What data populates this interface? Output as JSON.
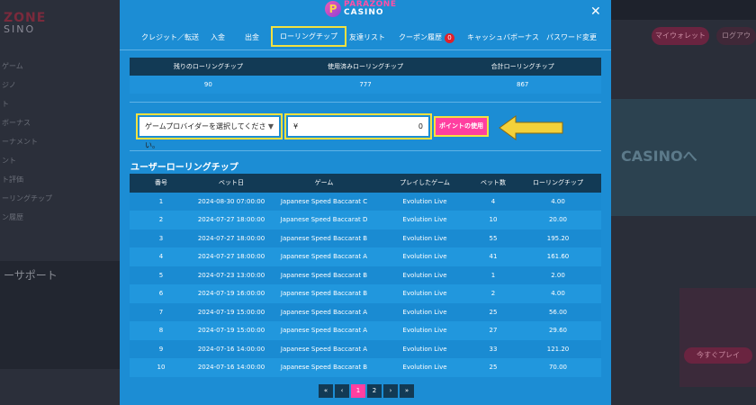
{
  "brand": {
    "line1": "PARAZONE",
    "line2": "CASINO",
    "badge": "P"
  },
  "background": {
    "logo_line1": "ZONE",
    "logo_line2": "SINO",
    "menu": [
      "ゲーム",
      "ジノ",
      "ト",
      "ボーナス",
      "ーナメント",
      "ント",
      "ト評価",
      "ーリングチップ",
      "ン履歴"
    ],
    "support_title": "ーサポート",
    "wallet_button": "マイウォレット",
    "login_button": "ログアウ",
    "banner_text": "CASINOへ",
    "lucky_button": "今すぐプレイ"
  },
  "tabs": [
    {
      "label": "クレジット／転送",
      "active": false
    },
    {
      "label": "入金",
      "active": false
    },
    {
      "label": "出金",
      "active": false
    },
    {
      "label": "ローリングチップ",
      "active": true
    },
    {
      "label": "友達リスト",
      "active": false
    },
    {
      "label": "クーポン履歴",
      "active": false,
      "badge": "0"
    },
    {
      "label": "キャッシュバボーナス",
      "active": false
    },
    {
      "label": "パスワード変更",
      "active": false
    }
  ],
  "summary": {
    "headers": [
      "残りのローリングチップ",
      "使用済みローリングチップ",
      "合計ローリングチップ"
    ],
    "values": [
      "90",
      "777",
      "867"
    ]
  },
  "controls": {
    "provider_select": "ゲームプロバイダーを選択してください。",
    "currency": "¥",
    "amount": "0",
    "use_button": "ポイントの使用"
  },
  "history": {
    "title": "ユーザーローリングチップ",
    "headers": [
      "番号",
      "ベット日",
      "ゲーム",
      "プレイしたゲーム",
      "ベット数",
      "ローリングチップ"
    ],
    "rows": [
      [
        "1",
        "2024-08-30 07:00:00",
        "Japanese Speed Baccarat C",
        "Evolution Live",
        "4",
        "4.00"
      ],
      [
        "2",
        "2024-07-27 18:00:00",
        "Japanese Speed Baccarat D",
        "Evolution Live",
        "10",
        "20.00"
      ],
      [
        "3",
        "2024-07-27 18:00:00",
        "Japanese Speed Baccarat B",
        "Evolution Live",
        "55",
        "195.20"
      ],
      [
        "4",
        "2024-07-27 18:00:00",
        "Japanese Speed Baccarat A",
        "Evolution Live",
        "41",
        "161.60"
      ],
      [
        "5",
        "2024-07-23 13:00:00",
        "Japanese Speed Baccarat B",
        "Evolution Live",
        "1",
        "2.00"
      ],
      [
        "6",
        "2024-07-19 16:00:00",
        "Japanese Speed Baccarat B",
        "Evolution Live",
        "2",
        "4.00"
      ],
      [
        "7",
        "2024-07-19 15:00:00",
        "Japanese Speed Baccarat A",
        "Evolution Live",
        "25",
        "56.00"
      ],
      [
        "8",
        "2024-07-19 15:00:00",
        "Japanese Speed Baccarat A",
        "Evolution Live",
        "27",
        "29.60"
      ],
      [
        "9",
        "2024-07-16 14:00:00",
        "Japanese Speed Baccarat A",
        "Evolution Live",
        "33",
        "121.20"
      ],
      [
        "10",
        "2024-07-16 14:00:00",
        "Japanese Speed Baccarat B",
        "Evolution Live",
        "25",
        "70.00"
      ]
    ]
  },
  "pagination": {
    "first": "«",
    "prev": "‹",
    "pages": [
      "1",
      "2"
    ],
    "current": "1",
    "next": "›",
    "last": "»"
  },
  "colors": {
    "modal_bg": "#1c8dd4",
    "header_dark": "#123a55",
    "accent_pink": "#ff3fa0",
    "highlight_yellow": "#f3e140"
  }
}
